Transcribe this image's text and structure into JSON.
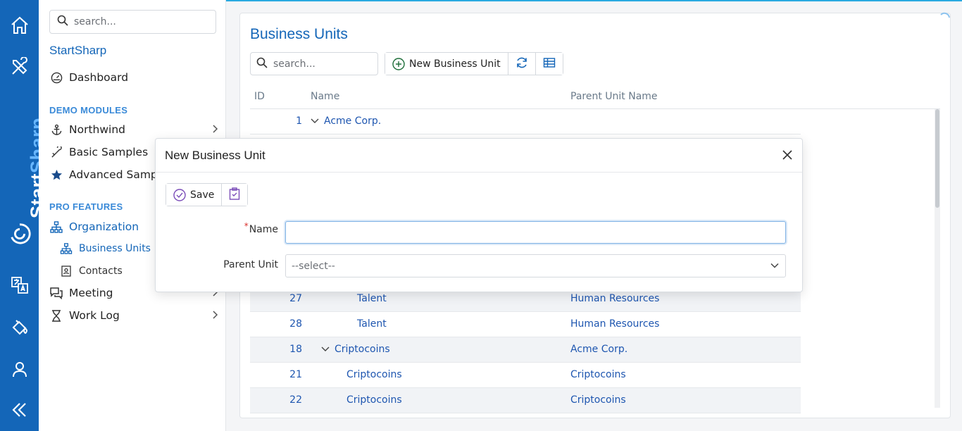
{
  "sidebar": {
    "search_placeholder": "search...",
    "app_title": "StartSharp",
    "dashboard": "Dashboard",
    "demo_header": "DEMO MODULES",
    "demo_items": [
      "Northwind",
      "Basic Samples",
      "Advanced Samples"
    ],
    "pro_header": "PRO FEATURES",
    "organization": "Organization",
    "org_sub": [
      "Business Units",
      "Contacts"
    ],
    "meeting": "Meeting",
    "work_log": "Work Log"
  },
  "rail": {
    "brand_part1": "Start",
    "brand_part2": "Sharp",
    "icons": [
      "home-icon",
      "tools-icon",
      "logo-icon",
      "translate-icon",
      "paint-bucket-icon",
      "user-icon",
      "collapse-icon"
    ]
  },
  "page": {
    "title": "Business Units",
    "search_placeholder": "search...",
    "new_button": "New Business Unit",
    "columns": {
      "id": "ID",
      "name": "Name",
      "parent": "Parent Unit Name"
    },
    "rows": [
      {
        "id": "1",
        "name": "Acme Corp.",
        "parent": "",
        "indent": 0,
        "expander": true
      },
      {
        "id": "27",
        "name": "Talent",
        "parent": "Human Resources",
        "indent": 2,
        "expander": false
      },
      {
        "id": "28",
        "name": "Talent",
        "parent": "Human Resources",
        "indent": 2,
        "expander": false
      },
      {
        "id": "18",
        "name": "Criptocoins",
        "parent": "Acme Corp.",
        "indent": 1,
        "expander": true
      },
      {
        "id": "21",
        "name": "Criptocoins",
        "parent": "Criptocoins",
        "indent": 2,
        "expander": false
      },
      {
        "id": "22",
        "name": "Criptocoins",
        "parent": "Criptocoins",
        "indent": 2,
        "expander": false
      }
    ]
  },
  "dialog": {
    "title": "New Business Unit",
    "save_label": "Save",
    "required_mark": "*",
    "name_label": "Name",
    "name_value": "",
    "parent_label": "Parent Unit",
    "parent_value": "--select--"
  },
  "colors": {
    "brand": "#1466b8",
    "link": "#1e56b0",
    "accent": "#29a9e0",
    "required": "#d9302c"
  }
}
